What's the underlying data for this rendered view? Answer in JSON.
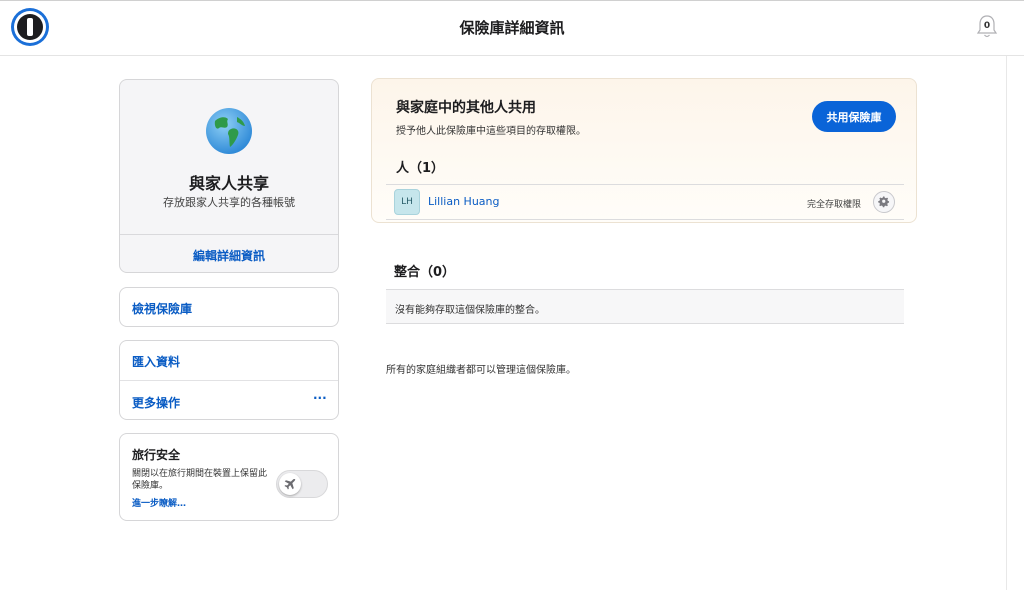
{
  "header": {
    "title": "保險庫詳細資訊",
    "notification_count": "0",
    "logo_icon": "1password-logo",
    "bell_icon": "bell-icon"
  },
  "vault": {
    "icon": "globe-icon",
    "name": "與家人共享",
    "description": "存放跟家人共享的各種帳號",
    "edit_label": "編輯詳細資訊"
  },
  "sidebar": {
    "view_vault": "檢視保險庫",
    "import_data": "匯入資料",
    "more_actions": "更多操作",
    "more_actions_icon": "···"
  },
  "travel": {
    "title": "旅行安全",
    "description": "關閉以在旅行期間在裝置上保留此保險庫。",
    "learn_more": "進一步瞭解…",
    "toggle_icon": "airplane-icon",
    "enabled": false
  },
  "share": {
    "title": "與家庭中的其他人共用",
    "subtitle": "授予他人此保險庫中這些項目的存取權限。",
    "button": "共用保險庫",
    "people_heading": "人（1）",
    "people": [
      {
        "initials": "LH",
        "name": "Lillian Huang",
        "access": "完全存取權限"
      }
    ]
  },
  "integrations": {
    "heading": "整合（0）",
    "empty_text": "沒有能夠存取這個保險庫的整合。"
  },
  "footer_note": "所有的家庭組織者都可以管理這個保險庫。",
  "colors": {
    "accent": "#0a64d8",
    "link": "#0a5cc4",
    "avatar_bg": "#c6e6ec"
  }
}
